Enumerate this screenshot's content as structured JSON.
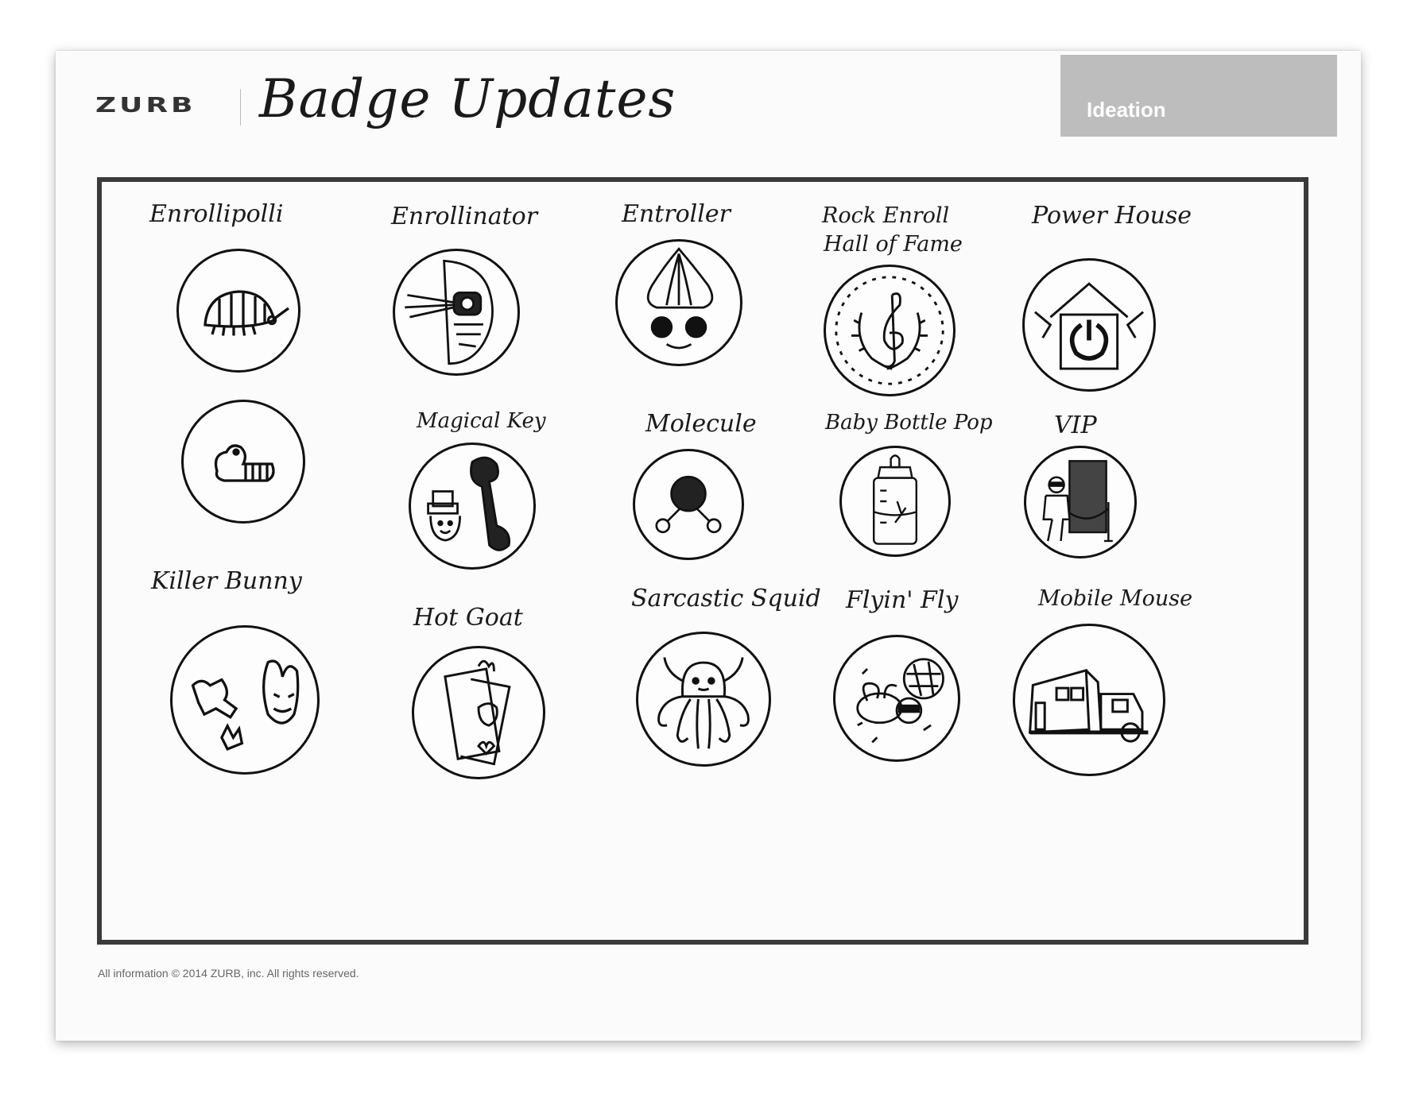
{
  "header": {
    "logo": "ZURB",
    "title": "Badge Updates",
    "stage": "Ideation"
  },
  "badges": [
    {
      "name": "Enrollipolli",
      "icon": "pill-bug-icon"
    },
    {
      "name": "",
      "icon": "curled-bug-icon"
    },
    {
      "name": "Enrollinator",
      "icon": "cyborg-face-icon"
    },
    {
      "name": "Magical Key",
      "icon": "leprechaun-key-icon"
    },
    {
      "name": "Entroller",
      "icon": "troll-face-icon"
    },
    {
      "name": "Molecule",
      "icon": "molecule-icon"
    },
    {
      "name": "Rock Enroll",
      "name2": "Hall of Fame",
      "icon": "treble-clef-laurel-icon"
    },
    {
      "name": "Baby Bottle Pop",
      "icon": "baby-bottle-icon"
    },
    {
      "name": "Power House",
      "icon": "power-house-icon"
    },
    {
      "name": "VIP",
      "icon": "vip-rope-icon"
    },
    {
      "name": "Killer Bunny",
      "icon": "killer-bunny-icon"
    },
    {
      "name": "Hot Goat",
      "icon": "goat-card-icon"
    },
    {
      "name": "Sarcastic Squid",
      "icon": "octopus-icon"
    },
    {
      "name": "Flyin' Fly",
      "icon": "fly-sunglasses-icon"
    },
    {
      "name": "Mobile Mouse",
      "icon": "mobile-house-truck-icon"
    }
  ],
  "footer": {
    "text": "All information © 2014 ZURB, inc.  All rights reserved."
  }
}
